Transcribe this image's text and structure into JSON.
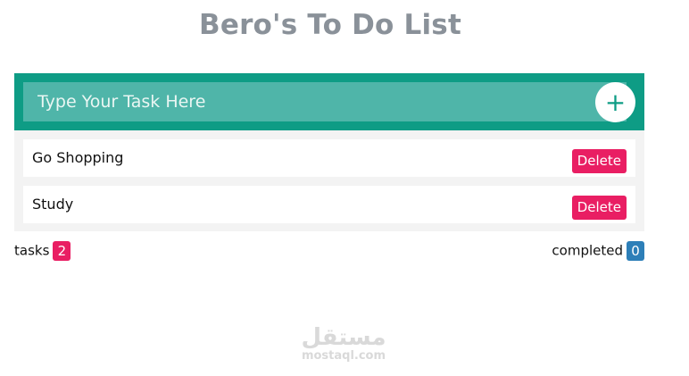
{
  "header": {
    "title": "Bero's To Do List"
  },
  "input": {
    "placeholder": "Type Your Task Here",
    "value": "",
    "add_label": "+"
  },
  "tasks": [
    {
      "text": "Go Shopping",
      "delete_label": "Delete"
    },
    {
      "text": "Study",
      "delete_label": "Delete"
    }
  ],
  "footer": {
    "tasks_label": "tasks",
    "tasks_count": "2",
    "completed_label": "completed",
    "completed_count": "0"
  },
  "watermark": {
    "arabic": "مستقل",
    "latin": "mostaql.com"
  },
  "colors": {
    "accent": "#0e9c85",
    "input_bg": "#4fb5a9",
    "delete": "#e91e63",
    "tasks_badge": "#e91e63",
    "completed_badge": "#2d7fb8",
    "title": "#8a9199"
  },
  "icons": {
    "add": "plus-icon"
  }
}
